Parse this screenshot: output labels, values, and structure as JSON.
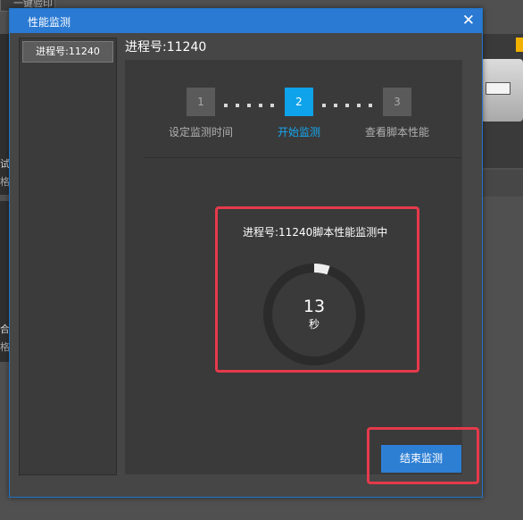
{
  "background": {
    "tab_label": "一键验印",
    "left_partial_1": "试",
    "left_partial_2": "格",
    "left_partial_3": "合",
    "left_partial_4": "格"
  },
  "dialog": {
    "title": "性能监测",
    "close_glyph": "✕"
  },
  "sidebar": {
    "items": [
      {
        "label": "进程号:11240",
        "selected": true
      }
    ]
  },
  "content": {
    "title": "进程号:11240"
  },
  "steps": [
    {
      "number": "1",
      "label": "设定监测时间",
      "state": "done"
    },
    {
      "number": "2",
      "label": "开始监测",
      "state": "active"
    },
    {
      "number": "3",
      "label": "查看脚本性能",
      "state": "pending"
    }
  ],
  "monitor": {
    "status_text": "进程号:11240脚本性能监测中",
    "elapsed_seconds": "13",
    "unit": "秒",
    "ring_progress_fraction": 0.05
  },
  "actions": {
    "end_button_label": "结束监测"
  },
  "colors": {
    "accent": "#2a7ad3",
    "step_active": "#0ea3ea",
    "highlight_border": "#e53a4b"
  }
}
